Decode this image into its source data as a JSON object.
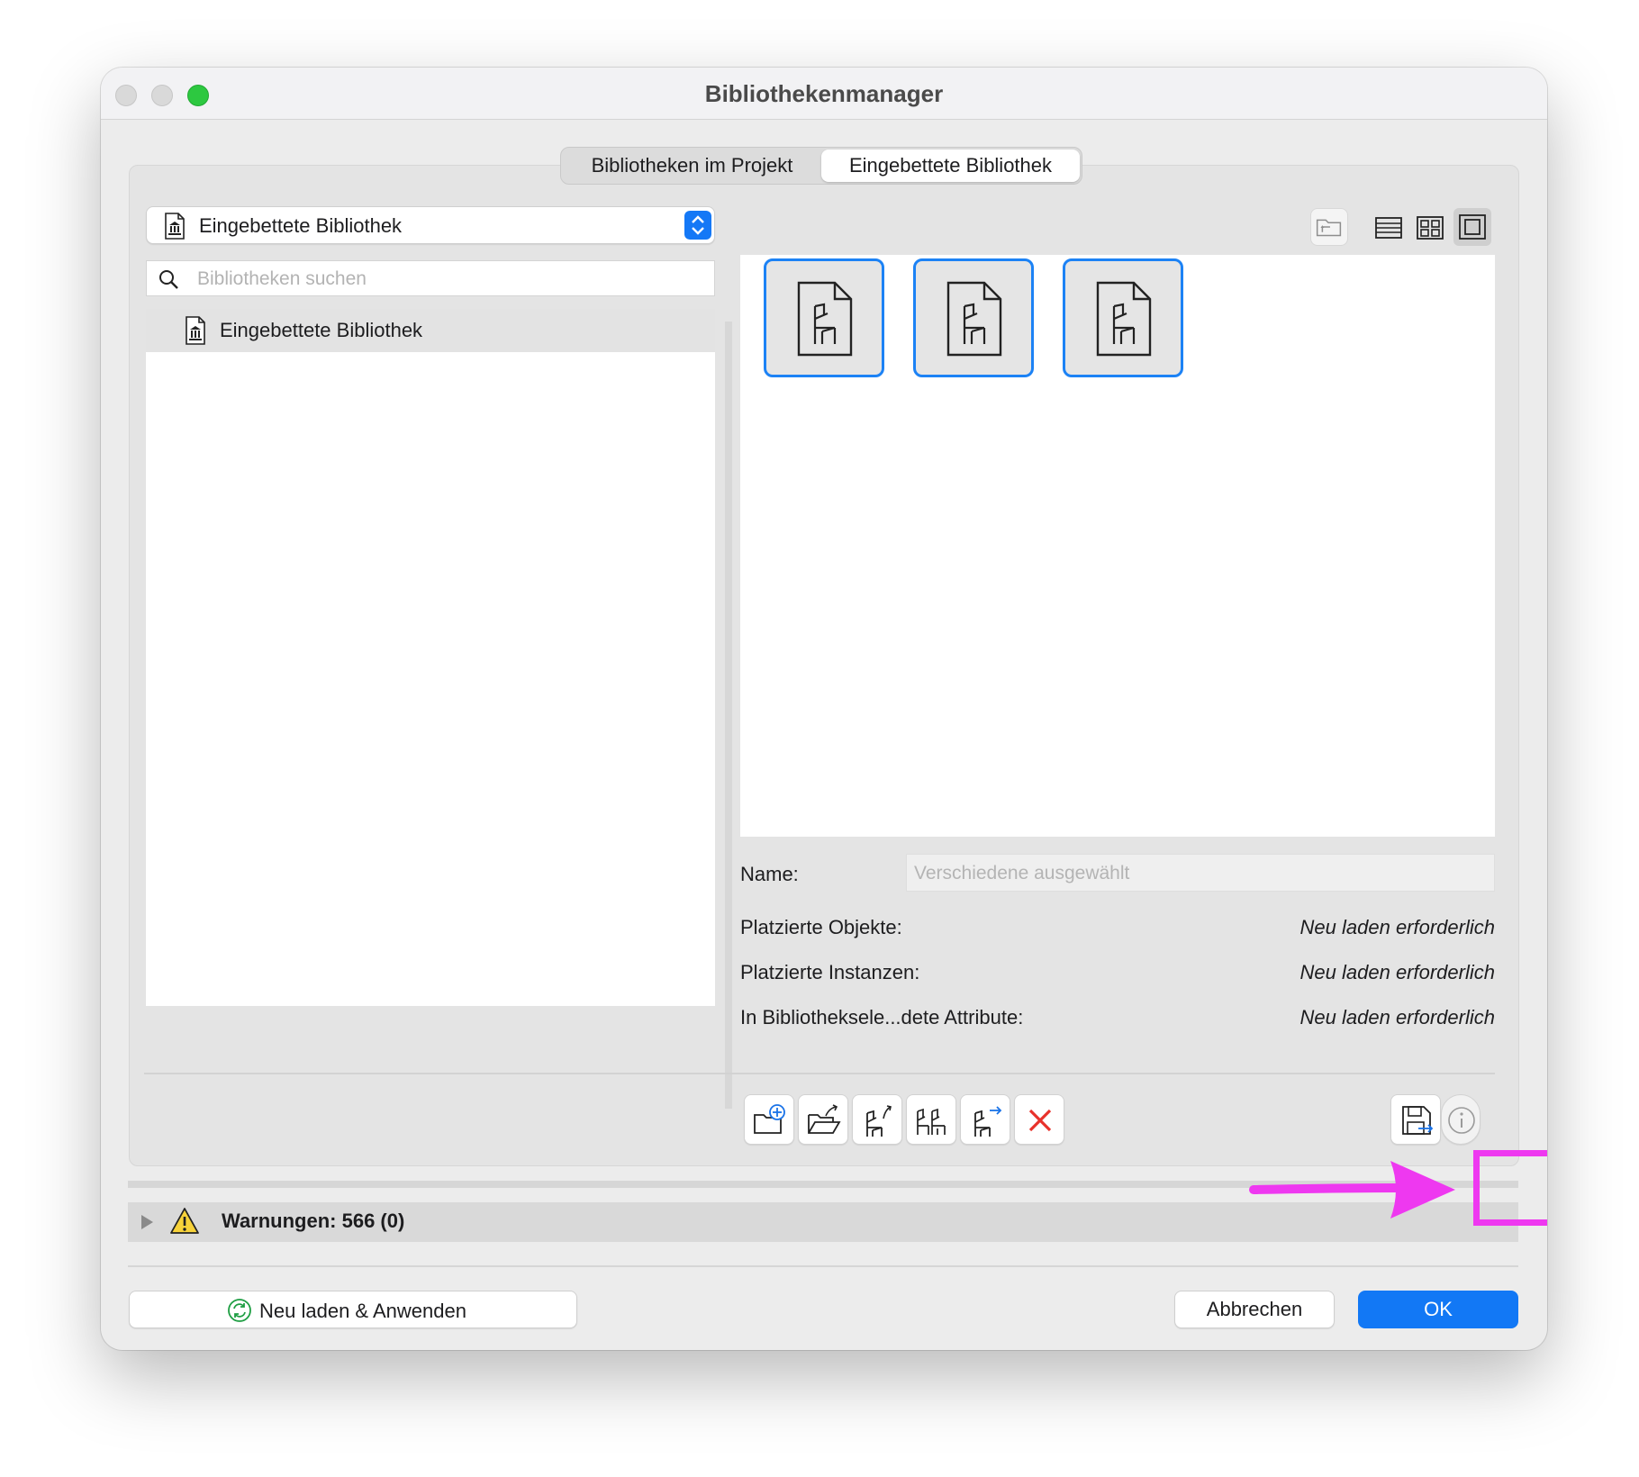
{
  "window": {
    "title": "Bibliothekenmanager"
  },
  "tabs": [
    {
      "label": "Bibliotheken im Projekt",
      "active": false
    },
    {
      "label": "Eingebettete Bibliothek",
      "active": true
    }
  ],
  "library_select": {
    "selected": "Eingebettete Bibliothek",
    "icon": "library-icon"
  },
  "search": {
    "placeholder": "Bibliotheken suchen",
    "value": ""
  },
  "tree": {
    "items": [
      {
        "label": "Eingebettete Bibliothek",
        "icon": "library-icon",
        "selected": true
      }
    ]
  },
  "view_controls": [
    "folder-up-icon",
    "list-view-icon",
    "grid-view-icon",
    "large-icon-view-icon"
  ],
  "objects": [
    {
      "icon": "chair-object-icon",
      "selected": true
    },
    {
      "icon": "chair-object-icon",
      "selected": true
    },
    {
      "icon": "chair-object-icon",
      "selected": true
    }
  ],
  "details": {
    "name_label": "Name:",
    "name_placeholder": "Verschiedene ausgewählt",
    "rows": [
      {
        "key": "Platzierte Objekte:",
        "value": "Neu laden erforderlich"
      },
      {
        "key": "Platzierte Instanzen:",
        "value": "Neu laden erforderlich"
      },
      {
        "key": "In Bibliotheksele...dete Attribute:",
        "value": "Neu laden erforderlich"
      }
    ]
  },
  "toolbar": [
    "new-folder-icon",
    "open-folder-icon",
    "export-object-icon",
    "duplicate-objects-icon",
    "move-object-icon",
    "delete-icon",
    "save-as-icon",
    "info-icon"
  ],
  "warnings": {
    "label": "Warnungen: 566 (0)"
  },
  "buttons": {
    "reload_apply": "Neu laden & Anwenden",
    "cancel": "Abbrechen",
    "ok": "OK"
  },
  "colors": {
    "accent": "#1278f5",
    "annotation": "#ee38f0",
    "delete": "#e8312a"
  }
}
